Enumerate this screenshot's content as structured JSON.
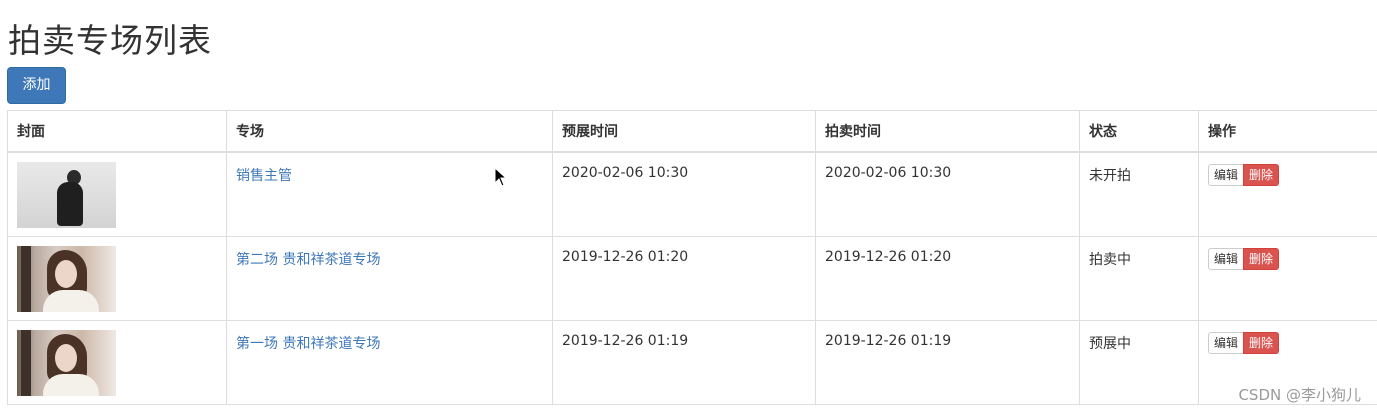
{
  "page": {
    "title": "拍卖专场列表"
  },
  "toolbar": {
    "add_label": "添加"
  },
  "table": {
    "headers": [
      "封面",
      "专场",
      "预展时间",
      "拍卖时间",
      "状态",
      "操作"
    ],
    "rows": [
      {
        "cover_icon": "person-in-black-hoodie",
        "name": "销售主管",
        "preview_time": "2020-02-06 10:30",
        "auction_time": "2020-02-06 10:30",
        "status": "未开拍",
        "edit_label": "编辑",
        "delete_label": "删除"
      },
      {
        "cover_icon": "woman-portrait",
        "name": "第二场 贵和祥茶道专场",
        "preview_time": "2019-12-26 01:20",
        "auction_time": "2019-12-26 01:20",
        "status": "拍卖中",
        "edit_label": "编辑",
        "delete_label": "删除"
      },
      {
        "cover_icon": "woman-portrait",
        "name": "第一场 贵和祥茶道专场",
        "preview_time": "2019-12-26 01:19",
        "auction_time": "2019-12-26 01:19",
        "status": "预展中",
        "edit_label": "编辑",
        "delete_label": "删除"
      }
    ]
  },
  "colors": {
    "primary": "#3f78b9",
    "danger": "#d9534f",
    "border": "#dddddd"
  },
  "watermark": "CSDN @李小狗儿"
}
